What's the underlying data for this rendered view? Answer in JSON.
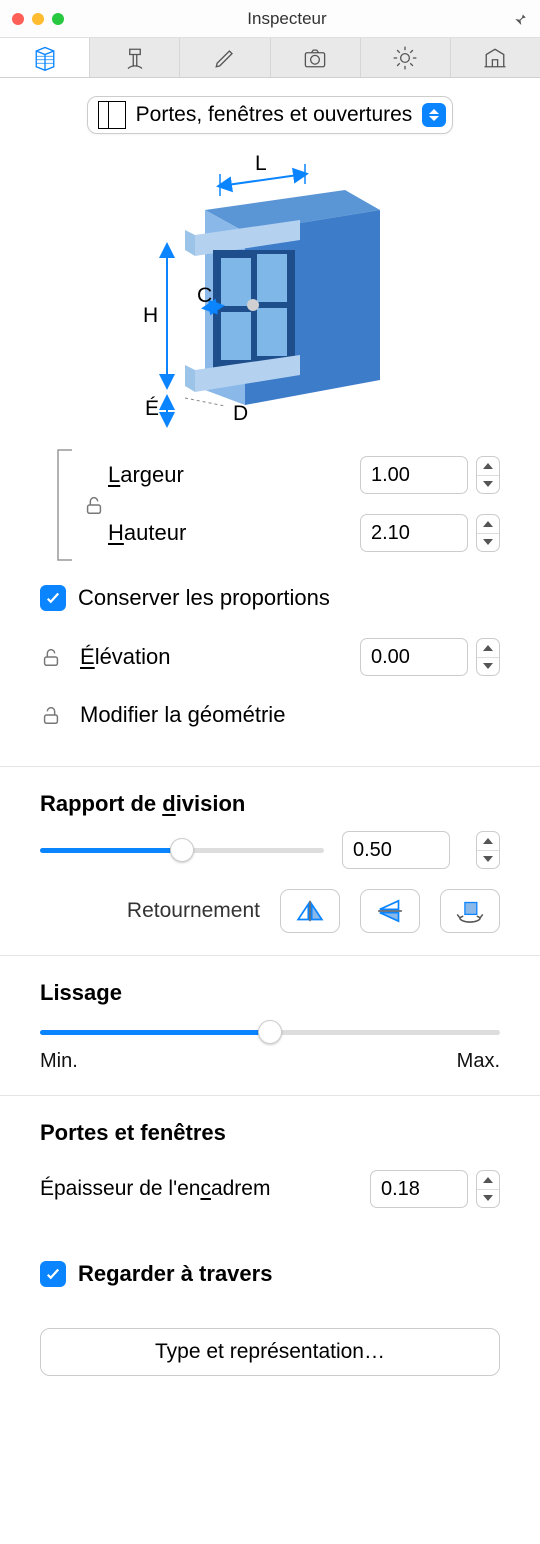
{
  "window": {
    "title": "Inspecteur"
  },
  "selector": {
    "label": "Portes, fenêtres et ouvertures"
  },
  "diagram": {
    "L": "L",
    "H": "H",
    "C": "C",
    "E": "É",
    "D": "D"
  },
  "dims": {
    "width_label_prefix": "L",
    "width_label_rest": "argeur",
    "width_value": "1.00",
    "height_label_prefix": "H",
    "height_label_rest": "auteur",
    "height_value": "2.10",
    "keep_prop_label": "Conserver les proportions",
    "keep_prop_checked": true,
    "elevation_label_prefix": "É",
    "elevation_label_rest": "lévation",
    "elevation_value": "0.00",
    "modify_geom_label": "Modifier la géométrie"
  },
  "division": {
    "title": "Rapport de ",
    "title_u": "d",
    "title_rest": "ivision",
    "value": "0.50",
    "ratio": 0.5,
    "flip_label": "Retournement"
  },
  "smoothing": {
    "title": "Lissage",
    "ratio": 0.5,
    "min": "Min.",
    "max": "Max."
  },
  "doors": {
    "title": "Portes et fenêtres",
    "thickness_label": "Épaisseur de l'en",
    "thickness_label_u": "c",
    "thickness_label_rest": "adrem",
    "thickness_value": "0.18"
  },
  "see_through": {
    "label": "Regarder à travers",
    "checked": true
  },
  "type_btn": {
    "label": "Type et représentation…"
  }
}
